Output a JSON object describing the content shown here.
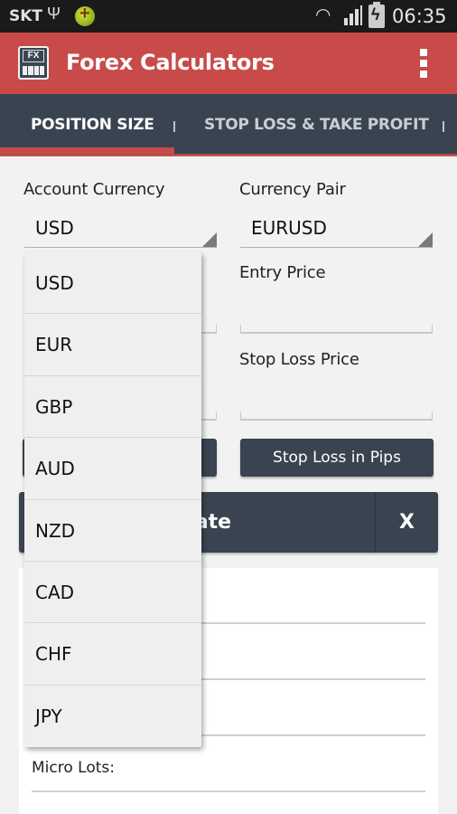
{
  "statusbar": {
    "carrier": "SKT",
    "usb_icon": "usb-icon",
    "app_notification_icon": "app-notification-icon",
    "wifi_icon": "wifi-icon",
    "signal_icon": "signal-icon",
    "battery_icon": "battery-charging-icon",
    "time": "06:35"
  },
  "appbar": {
    "icon": "fx-calculator-icon",
    "title": "Forex Calculators",
    "overflow_icon": "overflow-menu-icon"
  },
  "tabs": [
    {
      "label": "POSITION SIZE",
      "active": true
    },
    {
      "label": "STOP LOSS & TAKE PROFIT",
      "active": false
    }
  ],
  "colors": {
    "accent": "#c84b4a",
    "dark": "#3a4450",
    "background": "#f2f2f2"
  },
  "form": {
    "account_currency": {
      "label": "Account Currency",
      "value": "USD"
    },
    "currency_pair": {
      "label": "Currency Pair",
      "value": "EURUSD"
    },
    "entry_price": {
      "label": "Entry Price",
      "value": ""
    },
    "stop_loss_price": {
      "label": "Stop Loss Price",
      "value": ""
    },
    "stop_loss_pips_button": "Stop Loss in Pips"
  },
  "calculate": {
    "label": "Calculate",
    "visible_label": "alculate",
    "clear_label": "X"
  },
  "results": {
    "micro_lots_label": "Micro Lots:"
  },
  "dropdown": {
    "options": [
      "USD",
      "EUR",
      "GBP",
      "AUD",
      "NZD",
      "CAD",
      "CHF",
      "JPY"
    ]
  }
}
